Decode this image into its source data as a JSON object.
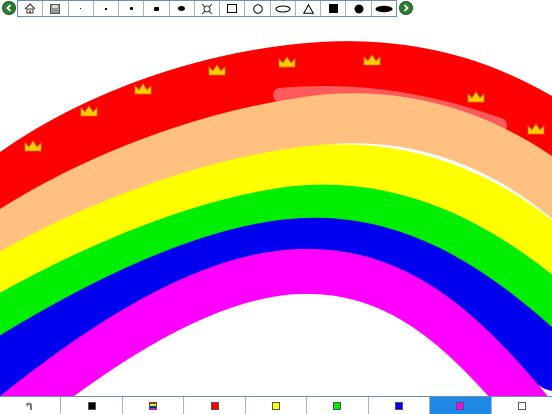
{
  "toolbar": {
    "tools": [
      {
        "name": "home-icon"
      },
      {
        "name": "save-icon"
      },
      {
        "name": "brush-size-1-icon"
      },
      {
        "name": "brush-size-2-icon"
      },
      {
        "name": "brush-size-3-icon"
      },
      {
        "name": "brush-size-4-icon"
      },
      {
        "name": "brush-size-5-icon"
      },
      {
        "name": "stamp-icon"
      },
      {
        "name": "rectangle-outline-icon"
      },
      {
        "name": "circle-outline-icon"
      },
      {
        "name": "ellipse-outline-icon"
      },
      {
        "name": "triangle-outline-icon"
      },
      {
        "name": "rectangle-filled-icon"
      },
      {
        "name": "circle-filled-icon"
      },
      {
        "name": "ellipse-filled-icon"
      }
    ],
    "prev_icon": "arrow-left-icon",
    "next_icon": "arrow-right-icon"
  },
  "canvas": {
    "stamp": "crown-icon",
    "stroke_colors": [
      "#ff0000",
      "#ffc080",
      "#ffff00",
      "#00ee00",
      "#0000ee",
      "#ff00ff"
    ]
  },
  "palette": {
    "undo_icon": "undo-icon",
    "colors": [
      {
        "name": "black",
        "hex": "#000000"
      },
      {
        "name": "multicolor",
        "hex": "multi"
      },
      {
        "name": "red",
        "hex": "#ff0000"
      },
      {
        "name": "yellow",
        "hex": "#ffff00"
      },
      {
        "name": "green",
        "hex": "#00ee00"
      },
      {
        "name": "blue",
        "hex": "#0000ee"
      },
      {
        "name": "magenta",
        "hex": "#ff00ff"
      },
      {
        "name": "white",
        "hex": "#ffffff"
      }
    ],
    "selected": "magenta",
    "selected_bg": "#1e88e5"
  }
}
